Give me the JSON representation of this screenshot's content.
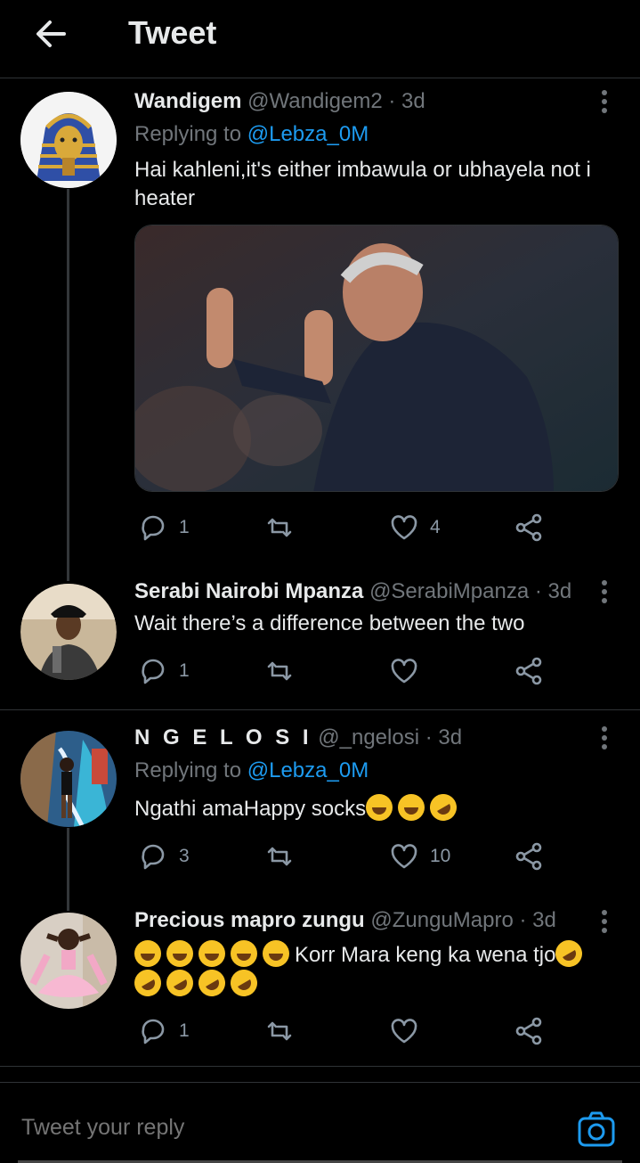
{
  "header": {
    "title": "Tweet"
  },
  "colors": {
    "accent": "#1d9bf0",
    "background": "#000000",
    "muted": "#71767b"
  },
  "tweets": [
    {
      "name": "Wandigem",
      "handle": "@Wandigem2",
      "time": "· 3d",
      "replying_label": "Replying to",
      "replying_to": "@Lebza_0M",
      "text": "Hai kahleni,it's either imbawula or ubhayela not i heater",
      "has_media": true,
      "replies": "1",
      "retweets": "",
      "likes": "4"
    },
    {
      "name": "Serabi Nairobi Mpanza",
      "handle": "@SerabiMpanza",
      "time": "· 3d",
      "text": "Wait there’s a difference between the two",
      "replies": "1",
      "retweets": "",
      "likes": ""
    },
    {
      "name": "N G E L O S I",
      "handle": "@_ngelosi",
      "time": "· 3d",
      "replying_label": "Replying to",
      "replying_to": "@Lebza_0M",
      "text": "Ngathi amaHappy socks",
      "emoji_suffix": [
        "joy",
        "joy",
        "rofl"
      ],
      "replies": "3",
      "retweets": "",
      "likes": "10"
    },
    {
      "name": "Precious mapro zungu",
      "handle": "@ZunguMapro",
      "time": "· 3d",
      "text": "Korr Mara keng ka wena tjo",
      "replies": "1",
      "retweets": "",
      "likes": ""
    }
  ],
  "reply": {
    "placeholder": "Tweet your reply"
  },
  "icons": [
    "back-arrow-icon",
    "more-vertical-icon",
    "reply-icon",
    "retweet-icon",
    "like-icon",
    "share-icon",
    "camera-icon"
  ]
}
